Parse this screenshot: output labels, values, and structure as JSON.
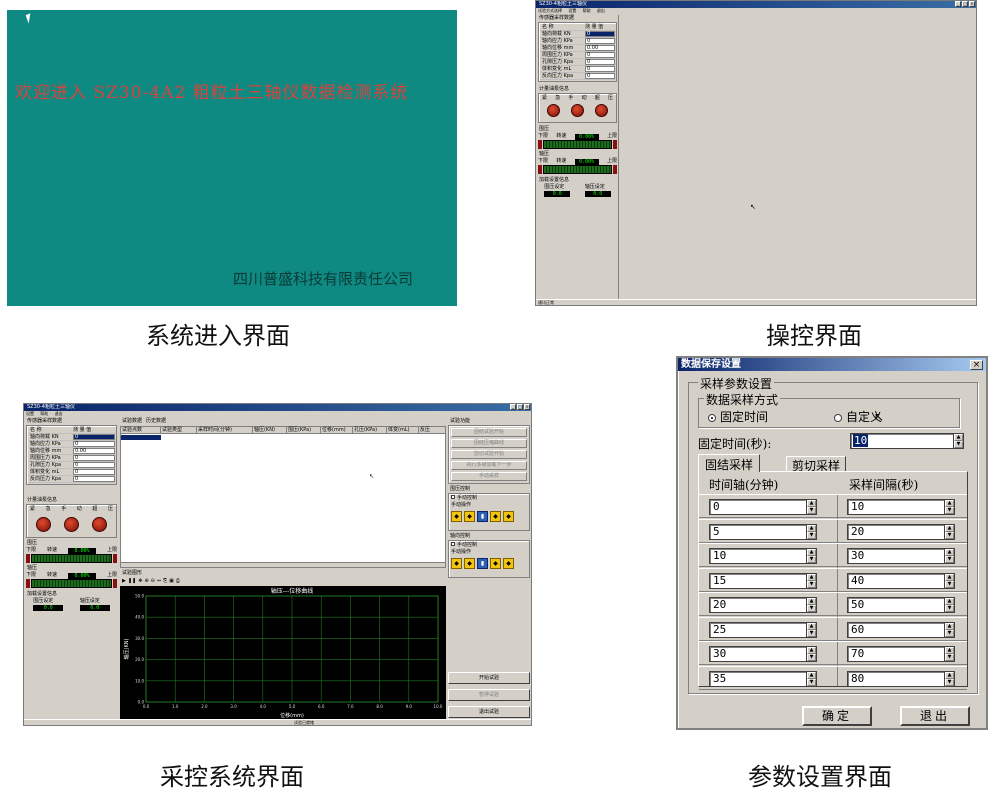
{
  "panel1": {
    "welcome": "欢迎进入 SZ30-4A2 粗粒土三轴仪数据检测系统",
    "company": "四川普盛科技有限责任公司",
    "caption": "系统进入界面"
  },
  "panel2": {
    "caption": "操控界面",
    "title": "SZ30-4粗粒土三轴仪",
    "menu": [
      "试验方式选择",
      "设置",
      "帮助",
      "退出"
    ],
    "sensor_group": "传感器采样数据",
    "col_name": "名  称",
    "col_value": "测 量 值",
    "sensors": [
      {
        "name": "轴向荷载 KN",
        "value": "0"
      },
      {
        "name": "轴向应力 KPa",
        "value": "0"
      },
      {
        "name": "轴向位移 mm",
        "value": "0.00"
      },
      {
        "name": "周围压力 KPa",
        "value": "0"
      },
      {
        "name": "孔隙压力 Kpa",
        "value": "0"
      },
      {
        "name": "体积变化 mL",
        "value": "0"
      },
      {
        "name": "反向压力 Kpa",
        "value": "0"
      }
    ],
    "pump_group": "计量油泵信息",
    "pump_labels": [
      "紧",
      "急",
      "手",
      "动",
      "超",
      "压"
    ],
    "confining_group": "围压",
    "axial_group": "轴压",
    "lower_limit": "下限",
    "upper_limit": "上限",
    "speed_label": "转速",
    "speed_value": "0.00%",
    "load_group": "加载设置信息",
    "confining_set": "围压设定",
    "axial_set": "轴压设定",
    "set_value": "0.0",
    "status": "通讯正常"
  },
  "panel3": {
    "caption": "采控系统界面",
    "title": "SZ30-4粗粒土三轴仪",
    "tabs": [
      "试验数据",
      "历史数据"
    ],
    "table_headers": [
      "试验点数",
      "试验类型",
      "采样时间(分钟)",
      "轴压(KN)",
      "围压(KPa)",
      "位移(mm)",
      "孔压(KPa)",
      "体变(mL)",
      "反压"
    ],
    "functions_group": "试验功能",
    "function_buttons": [
      "固结试验开始",
      "固结压缩曲线",
      "剪切试验开始",
      "执行多级加载下一步",
      "手动采样"
    ],
    "confining_ctrl": "围压控制",
    "axial_ctrl": "轴向控制",
    "manual_ctrl": "手动控制",
    "manual_op": "手动操作",
    "graph_group": "试验图形",
    "chart_title": "轴压---位移曲线",
    "chart_xlabel": "位移(mm)",
    "chart_ylabel": "轴压(KN)",
    "start_btn": "开始试验",
    "pause_btn": "暂停试验",
    "exit_btn": "退出试验",
    "status": "试验已就绪"
  },
  "chart_data": {
    "type": "line",
    "title": "轴压---位移曲线",
    "xlabel": "位移(mm)",
    "ylabel": "轴压(KN)",
    "x_ticks": [
      "0.0",
      "1.0",
      "2.0",
      "3.0",
      "4.0",
      "5.0",
      "6.0",
      "7.0",
      "8.0",
      "9.0",
      "10.0"
    ],
    "y_ticks": [
      "0.0",
      "10.0",
      "20.0",
      "30.0",
      "40.0",
      "50.0"
    ],
    "xlim": [
      0,
      10
    ],
    "ylim": [
      0,
      50
    ],
    "grid": true,
    "series": []
  },
  "panel4": {
    "caption": "参数设置界面",
    "title": "数据保存设置",
    "close": "×",
    "sample_group": "采样参数设置",
    "method_group": "数据采样方式",
    "opt_fixed": "固定时间",
    "opt_custom": "自定义",
    "fixed_label": "固定时间(秒):",
    "fixed_value": "10",
    "tab_consolidation": "固结采样",
    "tab_shear": "剪切采样",
    "col_time": "时间轴(分钟)",
    "col_interval": "采样间隔(秒)",
    "rows": [
      {
        "time": "0",
        "interval": "10"
      },
      {
        "time": "5",
        "interval": "20"
      },
      {
        "time": "10",
        "interval": "30"
      },
      {
        "time": "15",
        "interval": "40"
      },
      {
        "time": "20",
        "interval": "50"
      },
      {
        "time": "25",
        "interval": "60"
      },
      {
        "time": "30",
        "interval": "70"
      },
      {
        "time": "35",
        "interval": "80"
      }
    ],
    "ok": "确定",
    "exit": "退出"
  }
}
